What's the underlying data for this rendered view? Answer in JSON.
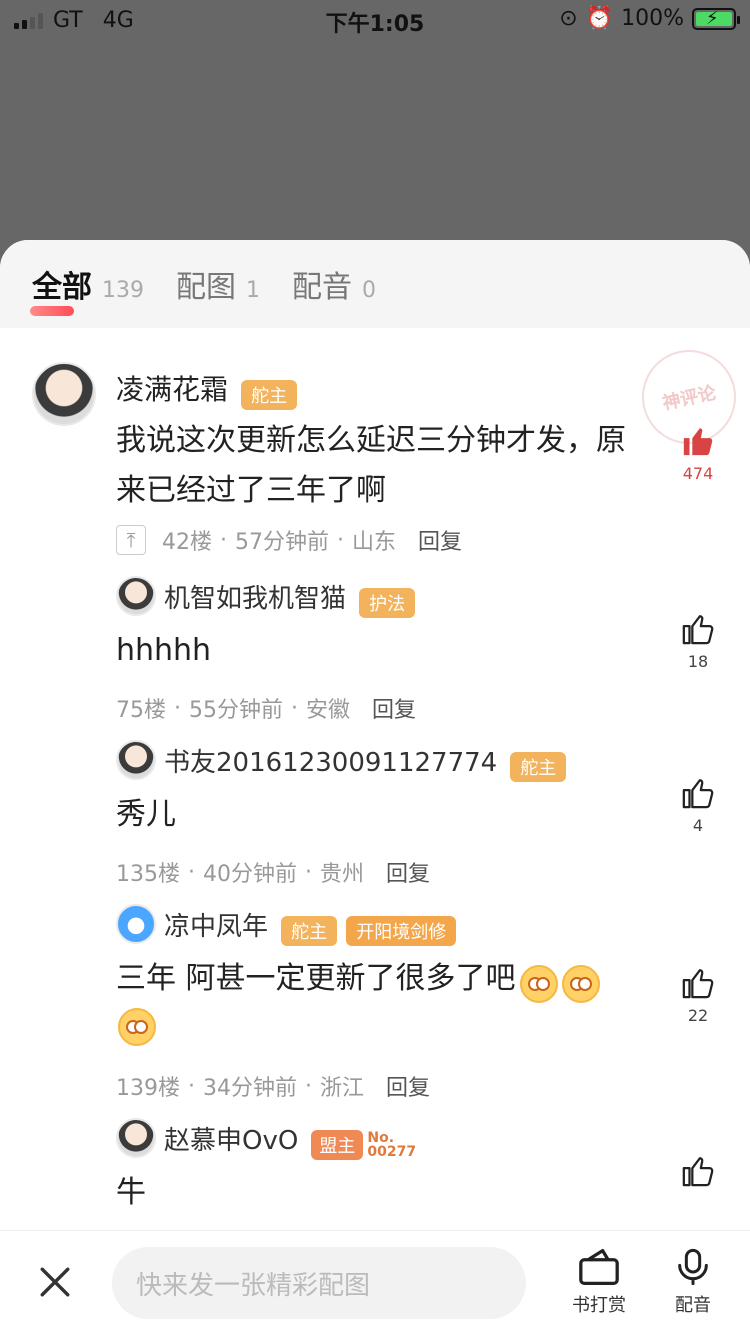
{
  "status_bar": {
    "carrier": "GT",
    "network": "4G",
    "time": "下午1:05",
    "battery": "100%"
  },
  "tabs": [
    {
      "label": "全部",
      "count": "139",
      "active": true
    },
    {
      "label": "配图",
      "count": "1",
      "active": false
    },
    {
      "label": "配音",
      "count": "0",
      "active": false
    }
  ],
  "watermark": "神评论",
  "comments": [
    {
      "name": "凌满花霜",
      "badges": [
        "舵主"
      ],
      "text": "我说这次更新怎么延迟三分钟才发，原来已经过了三年了啊",
      "meta": {
        "floor": "42楼",
        "time": "57分钟前",
        "location": "山东",
        "reply": "回复"
      },
      "likes": "474"
    },
    {
      "name": "机智如我机智猫",
      "badges": [
        "护法"
      ],
      "text": "hhhhh",
      "meta": {
        "floor": "75楼",
        "time": "55分钟前",
        "location": "安徽",
        "reply": "回复"
      },
      "likes": "18"
    },
    {
      "name": "书友20161230091127774",
      "badges": [
        "舵主"
      ],
      "text": "秀儿",
      "meta": {
        "floor": "135楼",
        "time": "40分钟前",
        "location": "贵州",
        "reply": "回复"
      },
      "likes": "4"
    },
    {
      "name": "凉中凤年",
      "badges": [
        "舵主",
        "开阳境剑修"
      ],
      "text": "三年 阿甚一定更新了很多了吧",
      "meta": {
        "floor": "139楼",
        "time": "34分钟前",
        "location": "浙江",
        "reply": "回复"
      },
      "likes": "22"
    },
    {
      "name": "赵慕申OvO",
      "badges": [
        "盟主"
      ],
      "badge_no_label": "No.",
      "badge_no_value": "00277",
      "text": "牛",
      "likes": ""
    }
  ],
  "bottom_bar": {
    "input_placeholder": "快来发一张精彩配图",
    "reward_label": "书打赏",
    "dub_label": "配音"
  },
  "colors": {
    "accent_red": "#d84343",
    "badge_yellow": "#f2b35c",
    "badge_orange": "#f08a54"
  }
}
